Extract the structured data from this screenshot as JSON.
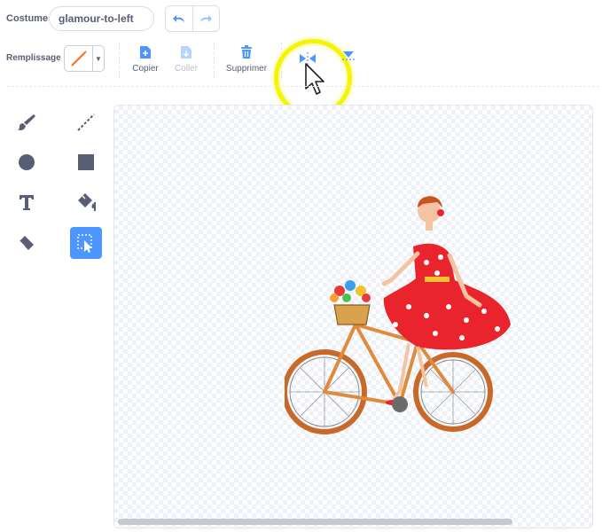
{
  "header": {
    "costume_label": "Costume",
    "costume_name": "glamour-to-left"
  },
  "toolbar": {
    "fill_label": "Remplissage",
    "copy_label": "Copier",
    "paste_label": "Coller",
    "delete_label": "Supprimer"
  },
  "icons": {
    "undo": "undo-icon",
    "redo": "redo-icon",
    "copy": "copy-icon",
    "paste": "paste-icon",
    "delete": "trash-icon",
    "flip_horizontal": "flip-horizontal-icon",
    "flip_vertical": "flip-vertical-icon",
    "cursor": "mouse-cursor-icon"
  },
  "tools": [
    {
      "name": "brush",
      "active": false
    },
    {
      "name": "line",
      "active": false
    },
    {
      "name": "circle",
      "active": false
    },
    {
      "name": "rectangle",
      "active": false
    },
    {
      "name": "text",
      "active": false
    },
    {
      "name": "fill",
      "active": false
    },
    {
      "name": "eraser",
      "active": false
    },
    {
      "name": "select",
      "active": true
    }
  ],
  "colors": {
    "accent": "#4c97ff",
    "text": "#575e75",
    "highlight": "#f5f500",
    "fill_swatch_line": "#ff6b1a"
  }
}
